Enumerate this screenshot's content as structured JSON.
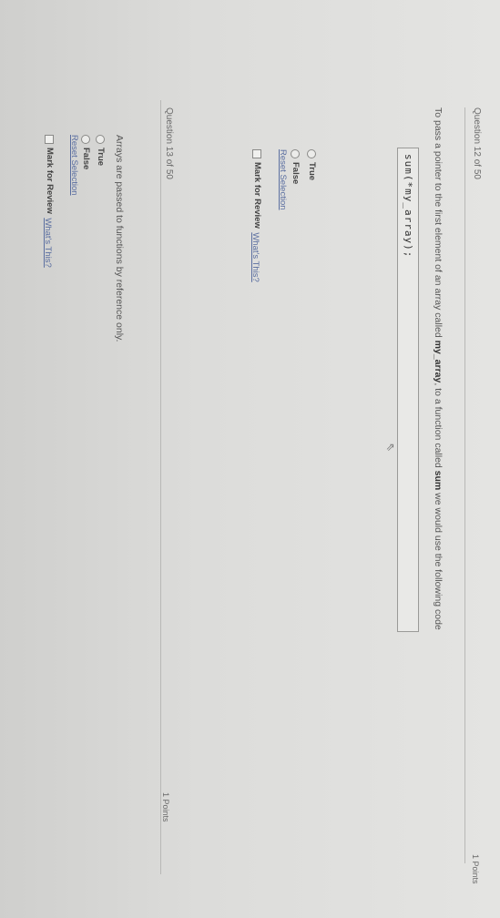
{
  "q12": {
    "header": "Question 12 of 50",
    "points": "1 Points",
    "prompt": {
      "before": "To pass a pointer to the first element of an array called ",
      "array_name": "my_array",
      "middle": ", to a function called ",
      "function_name": "sum",
      "after": " we would use the following code"
    },
    "code": "sum(*my_array);",
    "options": [
      "True",
      "False"
    ],
    "reset_label": "Reset Selection",
    "review_label": "Mark for Review",
    "whats_this": "What's This?"
  },
  "q13": {
    "header": "Question 13 of 50",
    "points": "1 Points",
    "prompt": "Arrays are passed to functions by reference only.",
    "options": [
      "True",
      "False"
    ],
    "reset_label": "Reset Selection",
    "review_label": "Mark for Review",
    "whats_this": "What's This?"
  },
  "icons": {
    "cursor": "mouse-pointer-icon"
  }
}
